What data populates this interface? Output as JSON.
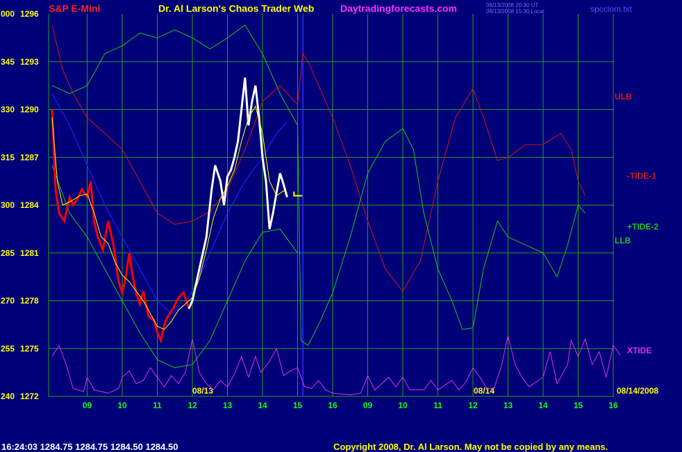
{
  "header": {
    "instrument": "S&P E-Mini",
    "title": "Dr. Al Larson's Chaos Trader Web",
    "site": "Daytradingforecasts.com",
    "stamp_line1": "08/13/2008 20:30 UT",
    "stamp_line2": "08/13/2008 15:30 Local",
    "file": "spcclom.txt"
  },
  "footer": {
    "quote": "16:24:03  1284.75  1284.75  1284.50  1284.50",
    "copyright": "Copyright 2008, Dr. Al Larson. May not be copied by any means."
  },
  "colors": {
    "background": "#000078",
    "grid": "#1fa01f",
    "price": "#ff0000",
    "price_recent": "#ffffff",
    "moving_average": "#ffff00",
    "ulb": "#e01010",
    "tide1": "#d01818",
    "tide2": "#18c818",
    "llb": "#18c818",
    "blue_line": "#2020ff",
    "xtide": "#e030e0",
    "now_marker": "#3030ff",
    "axis_label": "#ffff00",
    "x_tick_label": "#10ff10"
  },
  "chart_data": {
    "type": "line",
    "y_left_ticks": [
      {
        "t": "000",
        "p": "1296"
      },
      {
        "t": "345",
        "p": "1293"
      },
      {
        "t": "330",
        "p": "1290"
      },
      {
        "t": "315",
        "p": "1287"
      },
      {
        "t": "300",
        "p": "1284"
      },
      {
        "t": "285",
        "p": "1281"
      },
      {
        "t": "270",
        "p": "1278"
      },
      {
        "t": "255",
        "p": "1275"
      },
      {
        "t": "240",
        "p": "1272"
      }
    ],
    "ylim": [
      1272,
      1296
    ],
    "x_ticks": [
      "09",
      "10",
      "11",
      "12",
      "13",
      "14",
      "15",
      "16",
      "09",
      "10",
      "11",
      "12",
      "13",
      "14",
      "15",
      "16"
    ],
    "date_labels": [
      "08/13",
      "08/14"
    ],
    "right_date": "08/14/2008",
    "now_x": 7.15,
    "price": [
      [
        0.0,
        1290.0
      ],
      [
        0.1,
        1285.0
      ],
      [
        0.2,
        1283.5
      ],
      [
        0.35,
        1283.0
      ],
      [
        0.5,
        1284.5
      ],
      [
        0.6,
        1284.0
      ],
      [
        0.7,
        1284.3
      ],
      [
        0.85,
        1285.0
      ],
      [
        1.0,
        1284.5
      ],
      [
        1.1,
        1285.5
      ],
      [
        1.2,
        1283.0
      ],
      [
        1.3,
        1282.0
      ],
      [
        1.45,
        1281.2
      ],
      [
        1.6,
        1283.0
      ],
      [
        1.75,
        1281.5
      ],
      [
        1.9,
        1279.2
      ],
      [
        2.0,
        1278.5
      ],
      [
        2.1,
        1279.5
      ],
      [
        2.2,
        1281.0
      ],
      [
        2.3,
        1279.5
      ],
      [
        2.4,
        1278.5
      ],
      [
        2.5,
        1277.8
      ],
      [
        2.6,
        1278.6
      ],
      [
        2.75,
        1277.0
      ],
      [
        2.9,
        1276.8
      ],
      [
        3.0,
        1276.0
      ],
      [
        3.1,
        1275.5
      ],
      [
        3.2,
        1276.5
      ],
      [
        3.3,
        1277.0
      ],
      [
        3.45,
        1277.5
      ],
      [
        3.6,
        1278.2
      ],
      [
        3.75,
        1278.5
      ],
      [
        3.9,
        1277.5
      ],
      [
        4.0,
        1278.0
      ],
      [
        4.1,
        1279.0
      ],
      [
        4.25,
        1280.5
      ],
      [
        4.4,
        1282.0
      ],
      [
        4.55,
        1285.0
      ],
      [
        4.65,
        1286.5
      ],
      [
        4.8,
        1285.5
      ],
      [
        4.9,
        1284.0
      ],
      [
        5.0,
        1285.8
      ],
      [
        5.1,
        1286.2
      ],
      [
        5.2,
        1287.0
      ],
      [
        5.3,
        1288.0
      ],
      [
        5.4,
        1290.0
      ],
      [
        5.5,
        1292.0
      ],
      [
        5.6,
        1289.0
      ],
      [
        5.7,
        1290.5
      ],
      [
        5.8,
        1291.5
      ],
      [
        5.9,
        1289.5
      ],
      [
        6.0,
        1287.0
      ],
      [
        6.1,
        1285.5
      ],
      [
        6.2,
        1282.5
      ],
      [
        6.3,
        1283.5
      ],
      [
        6.4,
        1284.8
      ],
      [
        6.5,
        1286.0
      ],
      [
        6.6,
        1285.3
      ],
      [
        6.7,
        1284.5
      ]
    ],
    "moving_average": [
      [
        0.0,
        1289.5
      ],
      [
        0.15,
        1285.5
      ],
      [
        0.3,
        1284.0
      ],
      [
        0.5,
        1284.2
      ],
      [
        0.8,
        1284.6
      ],
      [
        1.0,
        1284.7
      ],
      [
        1.2,
        1283.5
      ],
      [
        1.4,
        1282.0
      ],
      [
        1.6,
        1281.6
      ],
      [
        1.8,
        1280.4
      ],
      [
        2.0,
        1279.6
      ],
      [
        2.2,
        1279.2
      ],
      [
        2.4,
        1278.6
      ],
      [
        2.6,
        1278.0
      ],
      [
        2.8,
        1277.2
      ],
      [
        3.0,
        1276.4
      ],
      [
        3.2,
        1276.2
      ],
      [
        3.4,
        1276.7
      ],
      [
        3.6,
        1277.4
      ],
      [
        3.8,
        1277.8
      ],
      [
        4.0,
        1278.2
      ],
      [
        4.2,
        1279.4
      ],
      [
        4.4,
        1281.2
      ],
      [
        4.6,
        1283.2
      ],
      [
        4.8,
        1284.4
      ],
      [
        5.0,
        1285.2
      ],
      [
        5.2,
        1286.2
      ],
      [
        5.4,
        1288.0
      ],
      [
        5.6,
        1289.5
      ],
      [
        5.8,
        1290.2
      ],
      [
        6.0,
        1288.5
      ],
      [
        6.2,
        1285.5
      ],
      [
        6.4,
        1284.6
      ],
      [
        6.6,
        1284.9
      ],
      [
        6.7,
        1284.8
      ]
    ],
    "ulb": [
      [
        0.0,
        1295.3
      ],
      [
        0.3,
        1292.5
      ],
      [
        0.6,
        1291.0
      ],
      [
        1.0,
        1289.5
      ],
      [
        1.5,
        1288.5
      ],
      [
        2.0,
        1287.5
      ],
      [
        2.5,
        1285.5
      ],
      [
        3.0,
        1283.5
      ],
      [
        3.5,
        1282.8
      ],
      [
        4.0,
        1283.0
      ],
      [
        4.5,
        1283.6
      ],
      [
        5.0,
        1285.0
      ],
      [
        5.5,
        1287.5
      ],
      [
        6.0,
        1290.5
      ],
      [
        6.5,
        1291.5
      ],
      [
        7.0,
        1290.3
      ]
    ],
    "tide1": [
      [
        7.0,
        1290.3
      ],
      [
        7.15,
        1293.5
      ],
      [
        7.3,
        1293.0
      ],
      [
        7.6,
        1291.5
      ],
      [
        8.0,
        1289.5
      ],
      [
        8.5,
        1286.5
      ],
      [
        9.0,
        1283.0
      ],
      [
        9.5,
        1280.0
      ],
      [
        10.0,
        1278.6
      ],
      [
        10.5,
        1280.5
      ],
      [
        11.0,
        1285.5
      ],
      [
        11.5,
        1289.5
      ],
      [
        12.0,
        1291.3
      ],
      [
        12.3,
        1289.5
      ],
      [
        12.7,
        1286.8
      ],
      [
        13.0,
        1287.0
      ],
      [
        13.5,
        1287.8
      ],
      [
        14.0,
        1287.8
      ],
      [
        14.5,
        1288.5
      ],
      [
        14.8,
        1287.5
      ],
      [
        15.0,
        1285.5
      ],
      [
        15.2,
        1284.6
      ]
    ],
    "tide2": [
      [
        0.0,
        1291.5
      ],
      [
        0.5,
        1291.0
      ],
      [
        1.0,
        1291.5
      ],
      [
        1.5,
        1293.5
      ],
      [
        2.0,
        1294.0
      ],
      [
        2.5,
        1294.8
      ],
      [
        3.0,
        1294.5
      ],
      [
        3.5,
        1295.0
      ],
      [
        4.0,
        1294.5
      ],
      [
        4.5,
        1293.8
      ],
      [
        5.0,
        1294.5
      ],
      [
        5.5,
        1295.3
      ],
      [
        6.0,
        1293.5
      ],
      [
        6.5,
        1291.0
      ],
      [
        7.0,
        1289.0
      ],
      [
        7.1,
        1275.5
      ],
      [
        7.3,
        1275.2
      ],
      [
        7.6,
        1276.5
      ],
      [
        8.0,
        1278.5
      ],
      [
        8.5,
        1282.0
      ],
      [
        9.0,
        1286.0
      ],
      [
        9.5,
        1288.0
      ],
      [
        10.0,
        1288.8
      ],
      [
        10.3,
        1287.5
      ],
      [
        10.6,
        1283.5
      ],
      [
        11.0,
        1280.0
      ],
      [
        11.4,
        1278.0
      ],
      [
        11.7,
        1276.2
      ],
      [
        12.0,
        1276.3
      ],
      [
        12.3,
        1280.0
      ],
      [
        12.7,
        1283.0
      ],
      [
        13.0,
        1282.0
      ],
      [
        13.5,
        1281.5
      ],
      [
        14.0,
        1281.0
      ],
      [
        14.4,
        1279.5
      ],
      [
        14.7,
        1281.5
      ],
      [
        15.0,
        1284.0
      ],
      [
        15.2,
        1283.5
      ]
    ],
    "llb": [
      [
        0.0,
        1286.5
      ],
      [
        0.5,
        1283.5
      ],
      [
        1.0,
        1282.0
      ],
      [
        1.5,
        1280.0
      ],
      [
        2.0,
        1278.0
      ],
      [
        2.5,
        1276.0
      ],
      [
        3.0,
        1274.3
      ],
      [
        3.5,
        1273.8
      ],
      [
        4.0,
        1274.0
      ],
      [
        4.5,
        1275.5
      ],
      [
        5.0,
        1278.0
      ],
      [
        5.5,
        1280.5
      ],
      [
        6.0,
        1282.3
      ],
      [
        6.5,
        1282.5
      ],
      [
        7.0,
        1281.0
      ]
    ],
    "blue_line": [
      [
        0.0,
        1291.0
      ],
      [
        0.5,
        1289.0
      ],
      [
        1.0,
        1286.5
      ],
      [
        1.5,
        1284.0
      ],
      [
        2.0,
        1282.0
      ],
      [
        2.5,
        1280.0
      ],
      [
        3.0,
        1278.0
      ],
      [
        3.4,
        1277.2
      ],
      [
        3.8,
        1277.8
      ],
      [
        4.2,
        1279.5
      ],
      [
        4.6,
        1281.5
      ],
      [
        5.0,
        1283.5
      ],
      [
        5.5,
        1285.5
      ],
      [
        6.0,
        1287.0
      ],
      [
        6.4,
        1288.5
      ],
      [
        6.7,
        1289.2
      ]
    ],
    "xtide": [
      [
        0.0,
        1274.5
      ],
      [
        0.2,
        1275.2
      ],
      [
        0.4,
        1274.0
      ],
      [
        0.6,
        1272.5
      ],
      [
        0.9,
        1272.3
      ],
      [
        1.0,
        1273.2
      ],
      [
        1.2,
        1272.4
      ],
      [
        1.6,
        1272.2
      ],
      [
        1.9,
        1272.5
      ],
      [
        2.0,
        1273.2
      ],
      [
        2.2,
        1273.6
      ],
      [
        2.4,
        1272.8
      ],
      [
        2.6,
        1273.0
      ],
      [
        2.8,
        1273.8
      ],
      [
        3.0,
        1273.2
      ],
      [
        3.2,
        1272.6
      ],
      [
        3.4,
        1273.3
      ],
      [
        3.6,
        1272.8
      ],
      [
        3.8,
        1273.5
      ],
      [
        4.0,
        1275.6
      ],
      [
        4.2,
        1273.5
      ],
      [
        4.4,
        1272.8
      ],
      [
        4.6,
        1272.4
      ],
      [
        4.8,
        1273.0
      ],
      [
        5.0,
        1272.6
      ],
      [
        5.2,
        1273.4
      ],
      [
        5.4,
        1274.5
      ],
      [
        5.6,
        1273.2
      ],
      [
        5.8,
        1274.5
      ],
      [
        5.95,
        1273.5
      ],
      [
        6.2,
        1274.2
      ],
      [
        6.4,
        1275.0
      ],
      [
        6.6,
        1273.3
      ],
      [
        6.8,
        1273.6
      ],
      [
        7.0,
        1273.8
      ],
      [
        7.2,
        1272.6
      ],
      [
        7.4,
        1272.5
      ],
      [
        7.6,
        1273.0
      ],
      [
        7.8,
        1272.4
      ],
      [
        8.0,
        1272.2
      ],
      [
        8.5,
        1272.1
      ],
      [
        8.8,
        1272.2
      ],
      [
        9.0,
        1273.3
      ],
      [
        9.2,
        1272.4
      ],
      [
        9.6,
        1273.2
      ],
      [
        9.8,
        1272.6
      ],
      [
        10.0,
        1273.2
      ],
      [
        10.2,
        1272.4
      ],
      [
        10.6,
        1272.4
      ],
      [
        10.8,
        1273.0
      ],
      [
        11.0,
        1272.4
      ],
      [
        11.4,
        1273.0
      ],
      [
        11.6,
        1272.4
      ],
      [
        11.8,
        1272.9
      ],
      [
        12.0,
        1273.8
      ],
      [
        12.2,
        1273.2
      ],
      [
        12.4,
        1272.5
      ],
      [
        12.6,
        1272.5
      ],
      [
        12.8,
        1273.8
      ],
      [
        13.0,
        1275.8
      ],
      [
        13.2,
        1274.0
      ],
      [
        13.4,
        1273.2
      ],
      [
        13.6,
        1272.6
      ],
      [
        14.0,
        1273.2
      ],
      [
        14.2,
        1274.8
      ],
      [
        14.4,
        1272.8
      ],
      [
        14.7,
        1274.0
      ],
      [
        14.8,
        1275.5
      ],
      [
        15.0,
        1274.5
      ],
      [
        15.2,
        1275.6
      ],
      [
        15.4,
        1274.0
      ],
      [
        15.6,
        1274.8
      ],
      [
        15.8,
        1273.2
      ],
      [
        16.0,
        1275.2
      ],
      [
        16.2,
        1274.6
      ]
    ],
    "line_labels": {
      "ulb": "ULB",
      "tide1": "-TIDE-1",
      "tide2": "+TIDE-2",
      "llb": "LLB",
      "xtide": "XTIDE"
    }
  }
}
